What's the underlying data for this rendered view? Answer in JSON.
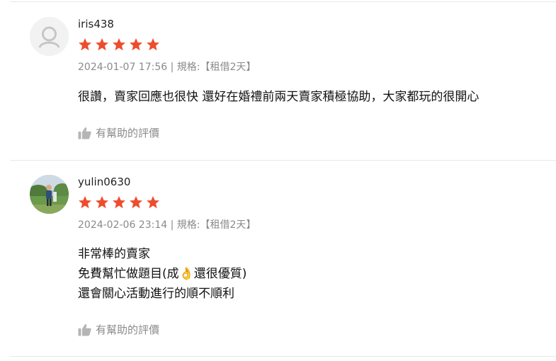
{
  "reviews": [
    {
      "username": "iris438",
      "rating": 5,
      "datetime": "2024-01-07 17:56",
      "separator": "|",
      "spec_label": "規格:",
      "spec_value": "租借2天",
      "comment_lines": [
        "很讚，賣家回應也很快 還好在婚禮前兩天賣家積極協助，大家都玩的很開心"
      ],
      "helpful_label": "有幫助的評價",
      "avatar": "default-user-icon"
    },
    {
      "username": "yulin0630",
      "rating": 5,
      "datetime": "2024-02-06 23:14",
      "separator": "|",
      "spec_label": "規格:",
      "spec_value": "租借2天",
      "comment_lines": [
        "非常棒的賣家",
        "免費幫忙做題目(成👌還很優質)",
        "還會關心活動進行的順不順利"
      ],
      "helpful_label": "有幫助的評價",
      "avatar": "photo-avatar"
    }
  ],
  "colors": {
    "star": "#ee4d2d",
    "muted": "#8a8a8a",
    "divider": "#e8e8e8"
  }
}
